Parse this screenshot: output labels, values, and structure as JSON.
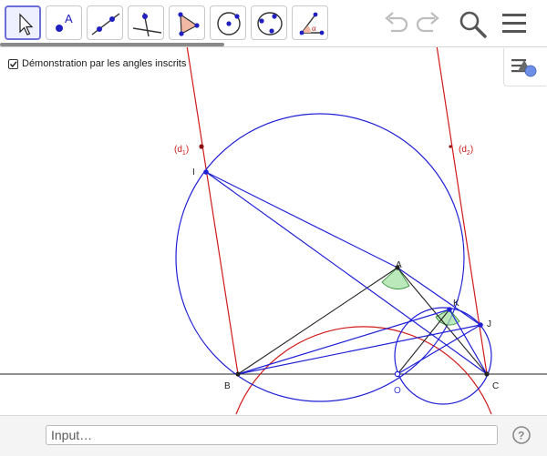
{
  "toolbar": {
    "tools": [
      {
        "name": "move-tool",
        "selected": true
      },
      {
        "name": "point-tool",
        "icon_letter": "A"
      },
      {
        "name": "line-tool"
      },
      {
        "name": "perpendicular-line-tool"
      },
      {
        "name": "polygon-tool"
      },
      {
        "name": "circle-center-point-tool"
      },
      {
        "name": "circle-three-points-tool"
      },
      {
        "name": "angle-tool",
        "icon_symbol": "α"
      }
    ],
    "right_icons": [
      "undo-icon",
      "redo-icon",
      "search-icon",
      "menu-icon"
    ]
  },
  "checkbox": {
    "label": "Démonstration par les angles inscrits",
    "checked": true
  },
  "construction": {
    "line_labels": {
      "d1": "(d",
      "d1_sub": "1",
      "d2": "(d",
      "d2_sub": "2",
      "close": ")"
    },
    "point_labels": {
      "A": "A",
      "B": "B",
      "C": "C",
      "I": "I",
      "J": "J",
      "K": "K",
      "O": "O"
    }
  },
  "colors": {
    "blue": "#1f1fd6",
    "red": "#d11a1a",
    "black": "#222222",
    "angle_fill": "#9fe09f",
    "triangle_icon": "#f3b8a4"
  },
  "input_bar": {
    "placeholder": "Input…"
  },
  "help": {
    "symbol": "?"
  }
}
